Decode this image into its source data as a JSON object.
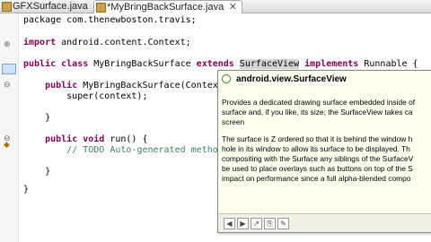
{
  "tabs": [
    {
      "label": "GFXSurface.java"
    },
    {
      "label": "*MyBringBackSurface.java",
      "close": "✕"
    }
  ],
  "code_lines": [
    {
      "segments": [
        {
          "t": "package com.thenewboston.travis;",
          "c": ""
        }
      ]
    },
    {
      "segments": [
        {
          "t": "import",
          "c": "kw"
        },
        {
          "t": " android.content.Context;",
          "c": ""
        }
      ]
    },
    {
      "segments": [
        {
          "t": "public class",
          "c": "kw"
        },
        {
          "t": " MyBringBackSurface ",
          "c": ""
        },
        {
          "t": "extends",
          "c": "kw"
        },
        {
          "t": " ",
          "c": ""
        },
        {
          "t": "SurfaceView",
          "c": "hl"
        },
        {
          "t": " ",
          "c": ""
        },
        {
          "t": "implements",
          "c": "kw"
        },
        {
          "t": " Runnable {",
          "c": ""
        }
      ]
    },
    {
      "segments": [
        {
          "t": "    ",
          "c": ""
        },
        {
          "t": "public",
          "c": "kw"
        },
        {
          "t": " MyBringBackSurface(Context con",
          "c": ""
        }
      ]
    },
    {
      "segments": [
        {
          "t": "        super(context);",
          "c": ""
        }
      ]
    },
    {
      "segments": [
        {
          "t": "    }",
          "c": ""
        }
      ]
    },
    {
      "segments": [
        {
          "t": "    ",
          "c": ""
        },
        {
          "t": "public void",
          "c": "kw"
        },
        {
          "t": " run() {",
          "c": ""
        }
      ]
    },
    {
      "segments": [
        {
          "t": "        ",
          "c": ""
        },
        {
          "t": "// TODO Auto-generated method st",
          "c": "cm"
        }
      ]
    },
    {
      "segments": [
        {
          "t": "    }",
          "c": ""
        }
      ]
    },
    {
      "segments": [
        {
          "t": "}",
          "c": ""
        }
      ]
    }
  ],
  "popup": {
    "title": "android.view.SurfaceView",
    "paragraph1_lines": [
      "Provides a dedicated drawing surface embedded inside of",
      "surface and, if you like, its size; the SurfaceView takes ca",
      "screen"
    ],
    "paragraph2_lines": [
      "The surface is Z ordered so that it is behind the window h",
      "hole in its window to allow its surface to be displayed. Th",
      "compositing with the Surface any siblings of the SurfaceV",
      "be used to place overlays such as buttons on top of the S",
      "impact on performance since a full alpha-blended compo"
    ],
    "footer_buttons": [
      "◀",
      "▶",
      "↗",
      "⎘",
      "✎"
    ]
  }
}
